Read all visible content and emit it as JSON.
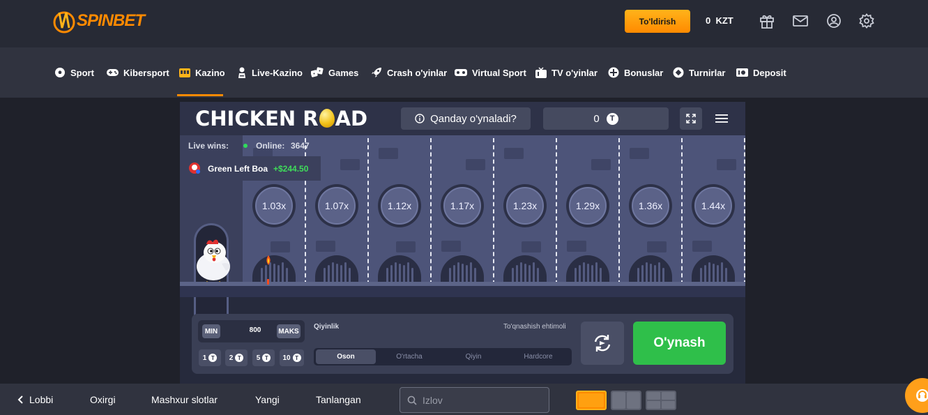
{
  "header": {
    "logo_text": "SPINBET",
    "deposit_label": "To'ldirish",
    "balance_amount": "0",
    "balance_currency": "KZT",
    "icons": [
      "gift-icon",
      "mail-icon",
      "user-icon",
      "settings-icon"
    ]
  },
  "nav": {
    "items": [
      {
        "label": "Sport",
        "icon": "soccer-ball-icon"
      },
      {
        "label": "Kibersport",
        "icon": "gamepad-icon"
      },
      {
        "label": "Kazino",
        "icon": "slot-machine-icon",
        "active": true
      },
      {
        "label": "Live-Kazino",
        "icon": "dealer-icon"
      },
      {
        "label": "Games",
        "icon": "dice-icon"
      },
      {
        "label": "Crash o'yinlar",
        "icon": "rocket-icon"
      },
      {
        "label": "Virtual Sport",
        "icon": "vr-icon"
      },
      {
        "label": "TV o'yinlar",
        "icon": "tv-icon"
      },
      {
        "label": "Bonuslar",
        "icon": "bonus-icon"
      },
      {
        "label": "Turnirlar",
        "icon": "tournament-icon"
      },
      {
        "label": "Deposit",
        "icon": "deposit-icon"
      }
    ],
    "accent": "#ff8a00"
  },
  "game": {
    "title_a": "CHICKEN R",
    "title_b": "AD",
    "how_to_play": "Qanday o'ynaladi?",
    "balance": "0",
    "currency_symbol": "T",
    "live_wins_label": "Live wins:",
    "online_label": "Online:",
    "online_count": "3647",
    "winner_name": "Green Left Boa",
    "winner_amount": "+$244.50",
    "multipliers": [
      "1.03x",
      "1.07x",
      "1.12x",
      "1.17x",
      "1.23x",
      "1.29x",
      "1.36x",
      "1.44x"
    ]
  },
  "controls": {
    "min_label": "MIN",
    "bet_value": "800",
    "max_label": "MAKS",
    "chips": [
      "1",
      "2",
      "5",
      "10"
    ],
    "difficulty_label": "Qiyinlik",
    "collision_label": "To'qnashish ehtimoli",
    "difficulty_options": [
      {
        "label": "Oson",
        "active": true
      },
      {
        "label": "O'rtacha",
        "active": false
      },
      {
        "label": "Qiyin",
        "active": false
      },
      {
        "label": "Hardcore",
        "active": false
      }
    ],
    "play_label": "O'ynash",
    "play_color": "#2fbf4a"
  },
  "bottom": {
    "lobby": "Lobbi",
    "items": [
      "Oxirgi",
      "Mashxur slotlar",
      "Yangi",
      "Tanlangan"
    ],
    "search_placeholder": "Izlov"
  }
}
